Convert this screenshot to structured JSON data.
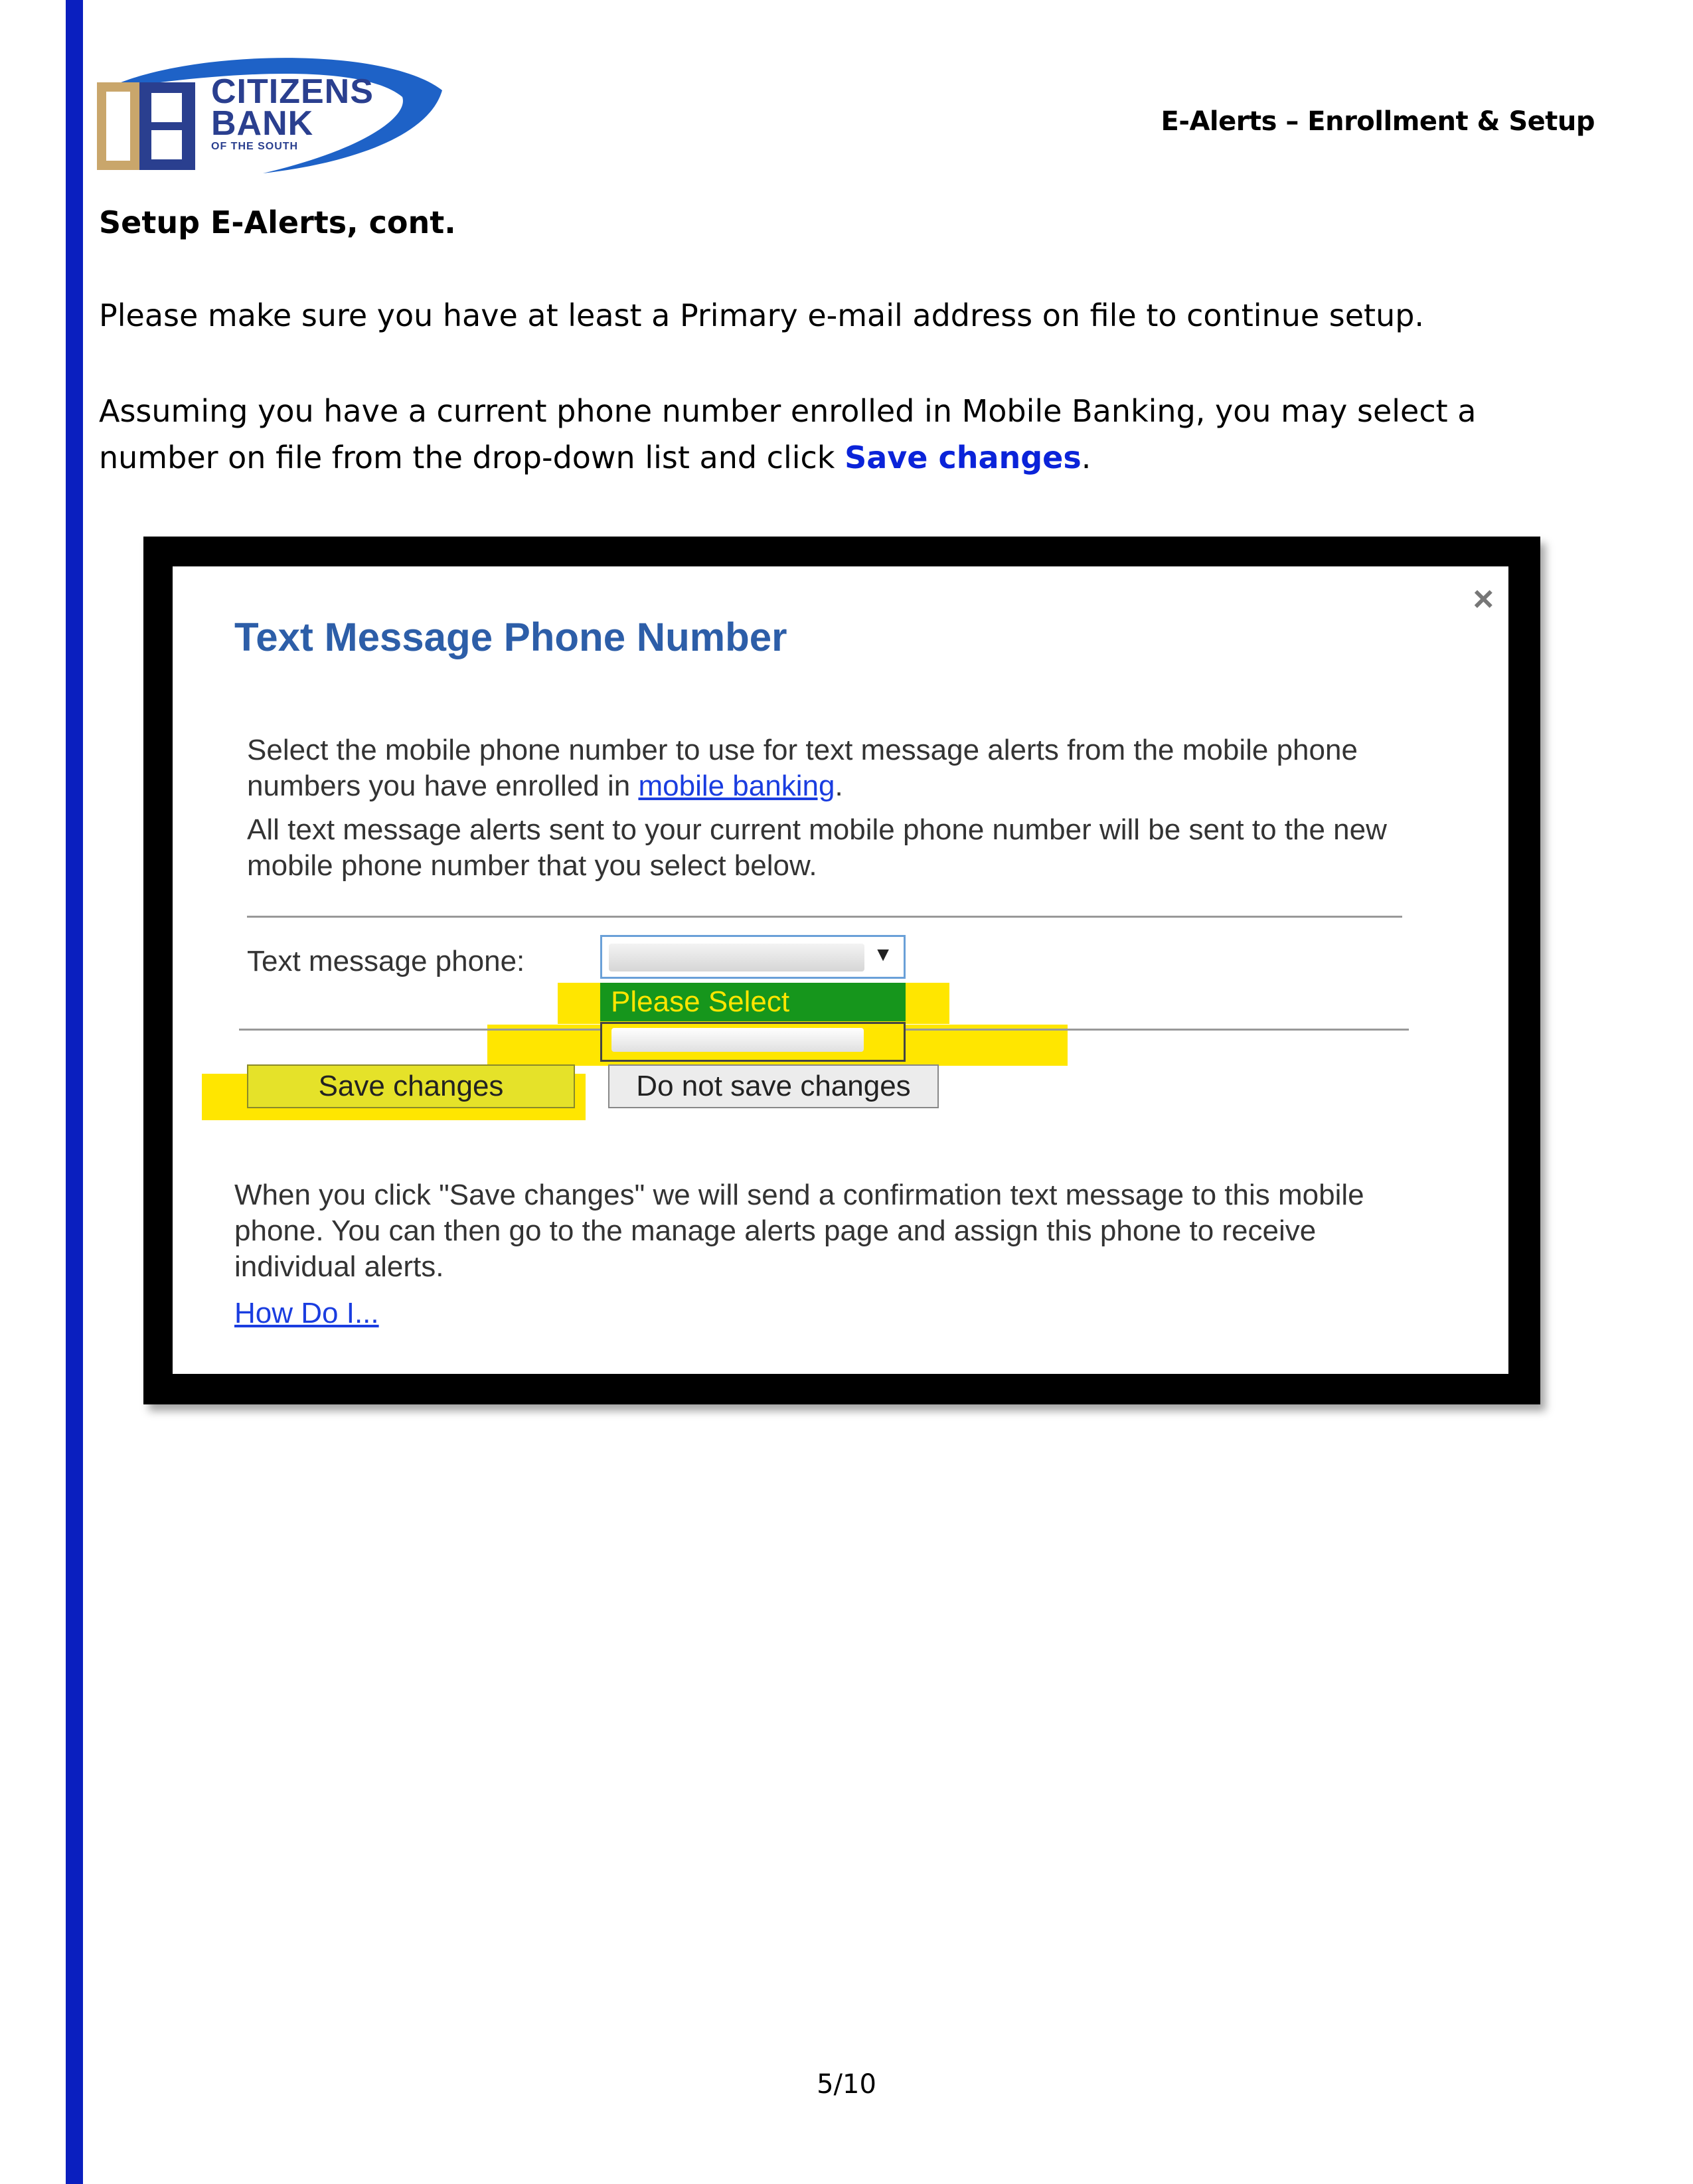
{
  "logo": {
    "line1": "CITIZENS",
    "line2": "BANK",
    "line3": "OF THE SOUTH",
    "mark": "CB"
  },
  "header": {
    "title": "E-Alerts – Enrollment & Setup"
  },
  "section": {
    "title": "Setup E-Alerts, cont."
  },
  "body": {
    "para1": "Please make sure you have at least a Primary e-mail address on file to continue setup.",
    "para2_pre": "Assuming you have a current phone number enrolled in Mobile Banking, you may select a number on file from the drop-down list and click ",
    "para2_link": "Save changes",
    "para2_post": "."
  },
  "dialog": {
    "close": "×",
    "title": "Text Message Phone Number",
    "intro_pre": "Select the mobile phone number to use for text message alerts from the mobile phone numbers you have enrolled in ",
    "intro_link": "mobile banking",
    "intro_post": ".",
    "intro2": "All text message alerts sent to your current mobile phone number will be sent to the new mobile phone number that you select below.",
    "phone_label": "Text message phone:",
    "dropdown_arrow": "▼",
    "option_selected": "Please Select",
    "save_button": "Save changes",
    "cancel_button": "Do not save changes",
    "note": "When you click \"Save changes\" we will send a confirmation text message to this mobile phone. You can then go to the manage alerts page and assign this phone to receive individual alerts.",
    "help_link": "How Do I..."
  },
  "footer": {
    "page": "5/10"
  },
  "colors": {
    "accent_blue": "#0a23d9",
    "rule_blue": "#0a1fbf",
    "dialog_title": "#2d5ea8",
    "highlight": "#ffe600",
    "option_green": "#16961c"
  }
}
